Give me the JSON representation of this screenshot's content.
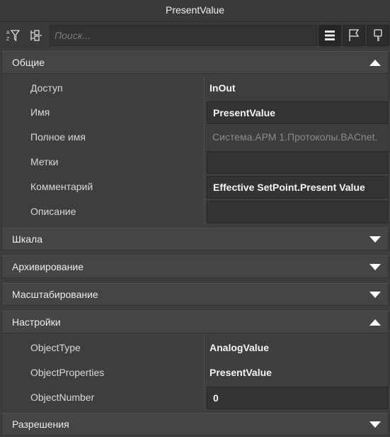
{
  "window": {
    "title": "PresentValue"
  },
  "toolbar": {
    "search_placeholder": "Поиск...",
    "icons": [
      "sort-az-filter-icon",
      "collapse-tree-icon",
      "list-view-icon",
      "flag-icon",
      "key-icon"
    ]
  },
  "sections": {
    "general": {
      "label": "Общие",
      "expanded": true,
      "rows": [
        {
          "name": "Доступ",
          "value": "InOut"
        },
        {
          "name": "Имя",
          "value": "PresentValue"
        },
        {
          "name": "Полное имя",
          "value": "Система.АРМ 1.Протоколы.BACnet."
        },
        {
          "name": "Метки",
          "value": ""
        },
        {
          "name": "Комментарий",
          "value": "Effective SetPoint.Present Value"
        },
        {
          "name": "Описание",
          "value": ""
        }
      ]
    },
    "scale": {
      "label": "Шкала",
      "expanded": false
    },
    "archiving": {
      "label": "Архивирование",
      "expanded": false
    },
    "scaling": {
      "label": "Масштабирование",
      "expanded": false
    },
    "settings": {
      "label": "Настройки",
      "expanded": true,
      "rows": [
        {
          "name": "ObjectType",
          "value": "AnalogValue"
        },
        {
          "name": "ObjectProperties",
          "value": "PresentValue"
        },
        {
          "name": "ObjectNumber",
          "value": "0"
        }
      ]
    },
    "permissions": {
      "label": "Разрешения",
      "expanded": false
    }
  },
  "colors": {
    "background": "#3d3d3d",
    "header": "#454545",
    "input": "#333333",
    "text": "#e6e6e6"
  }
}
